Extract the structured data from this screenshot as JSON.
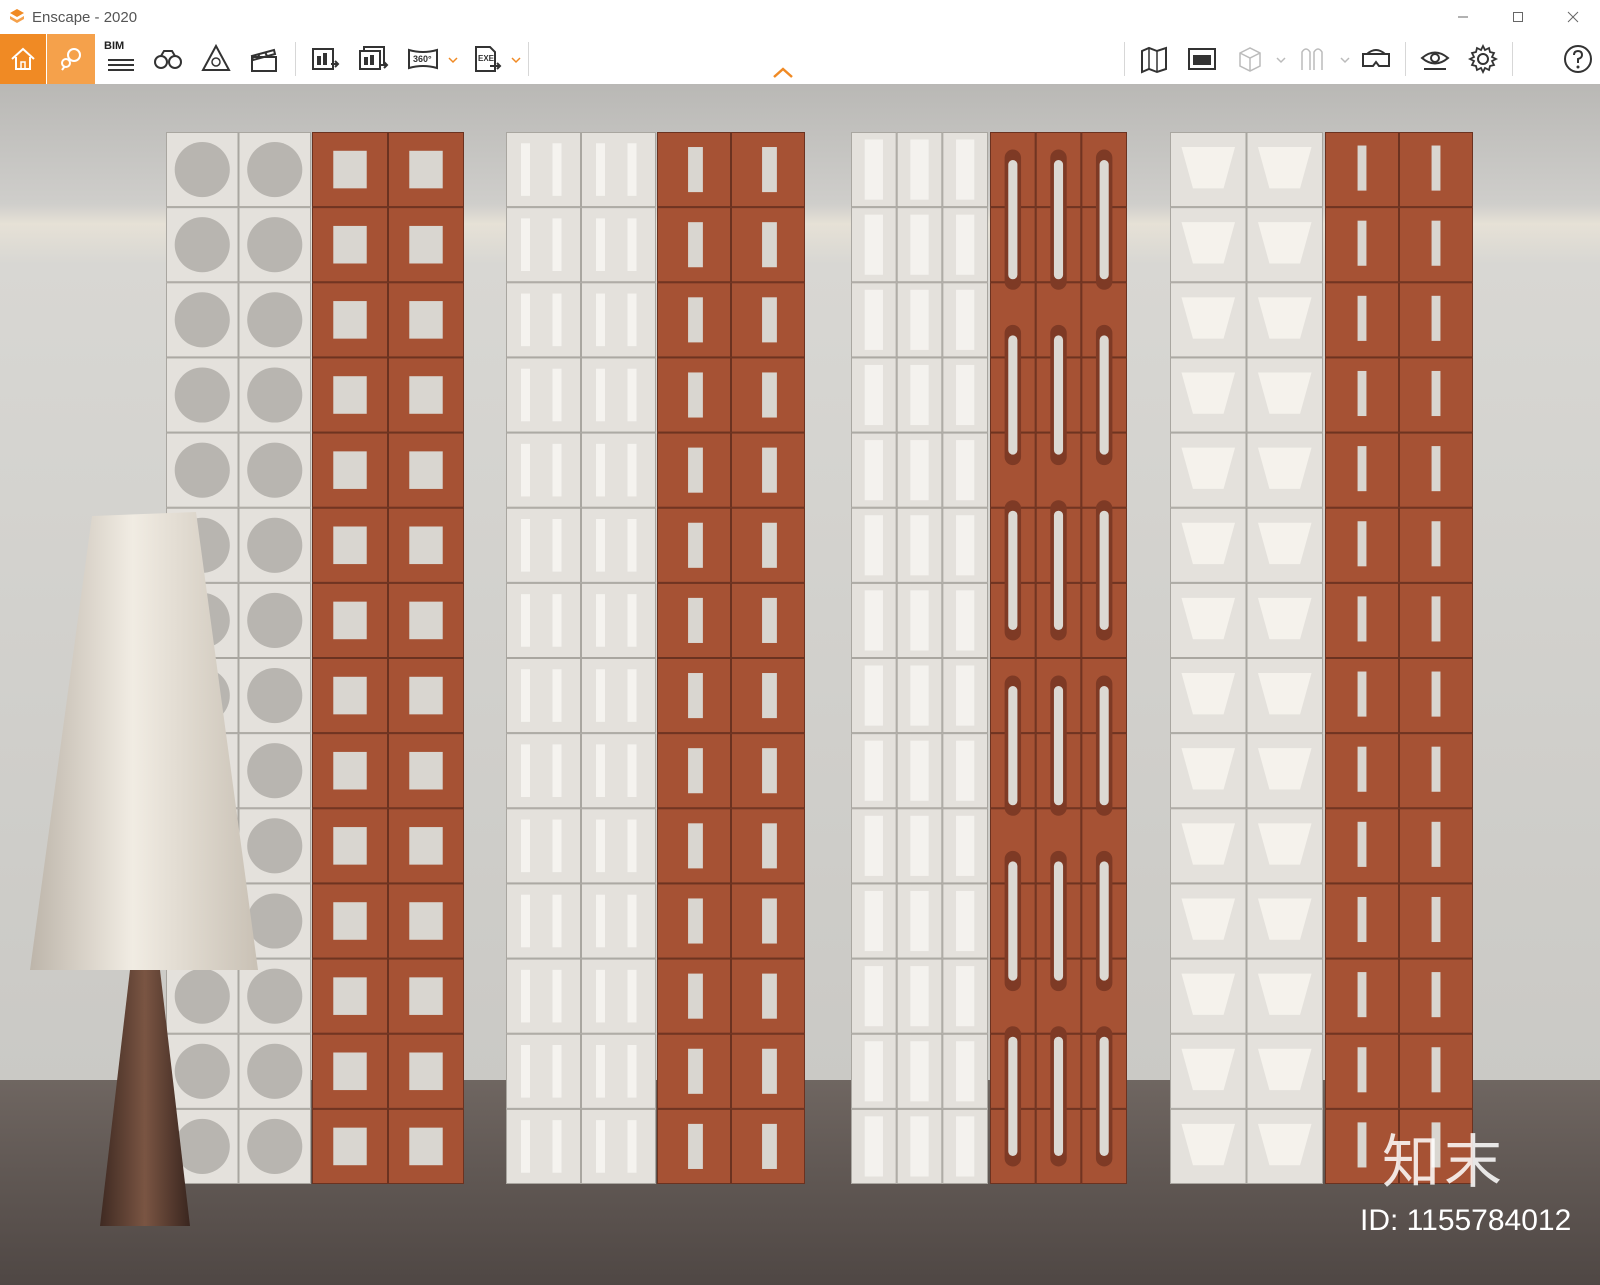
{
  "window": {
    "title": "Enscape - 2020"
  },
  "toolbar": {
    "bim_label": "BIM",
    "items": [
      "home-icon",
      "location-pin-icon",
      "bim-icon",
      "binoculars-icon",
      "perspective-icon",
      "clapper-icon",
      "render-image-icon",
      "batch-render-icon",
      "panorama-360-icon",
      "export-exe-icon",
      "map-icon",
      "asset-library-icon",
      "cube-icon",
      "sun-icon",
      "vr-headset-icon",
      "eye-icon",
      "gear-icon",
      "help-icon"
    ],
    "pano_label": "360°",
    "exe_label": "EXE",
    "accent": "#f08a24"
  },
  "scene": {
    "description_colors": {
      "white_block": "#e4e1dc",
      "terracotta_block": "#a65234",
      "wall": "#d4d3cf",
      "floor": "#5e5550"
    }
  },
  "watermark": {
    "logo": "知末",
    "id_text": "ID: 1155784012"
  }
}
